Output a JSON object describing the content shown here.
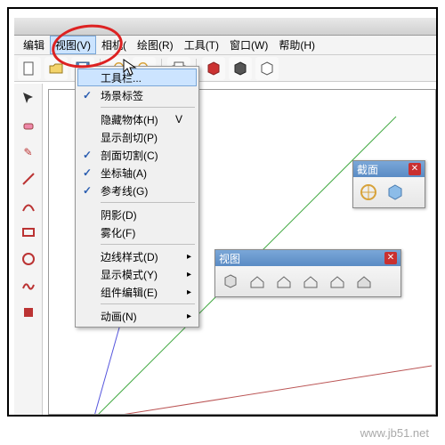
{
  "menubar": {
    "edit": "编辑",
    "view": "视图(V)",
    "camera": "相机(",
    "draw": "绘图(R)",
    "tools": "工具(T)",
    "window": "窗口(W)",
    "help": "帮助(H)"
  },
  "dropdown": {
    "toolbars": "工具栏...",
    "scene_tabs": "场景标签",
    "hidden": "隐藏物体(H)",
    "hidden_sc": "V",
    "section_planes": "显示剖切(P)",
    "section_cuts": "剖面切割(C)",
    "axes": "坐标轴(A)",
    "guides": "参考线(G)",
    "shadows": "阴影(D)",
    "fog": "雾化(F)",
    "edge_style": "边线样式(D)",
    "face_style": "显示模式(Y)",
    "component_edit": "组件编辑(E)",
    "animation": "动画(N)"
  },
  "float_views": {
    "title": "视图"
  },
  "float_section": {
    "title": "截面"
  },
  "watermark": "www.jb51.net",
  "icons": {
    "undo": "↶",
    "redo": "↷",
    "print": "⎙",
    "info": "ⓘ",
    "book": "◫",
    "select": "▭",
    "eraser": "◧",
    "pencil": "✎",
    "line": "／",
    "arc": "◠",
    "rect": "▭",
    "circle": "◯",
    "paint": "▮",
    "iso": "⬠",
    "top": "⌂",
    "front": "⌂",
    "right": "⌂",
    "back": "⌂",
    "left": "⌂",
    "persp": "▱",
    "section1": "◈",
    "section2": "⬢"
  }
}
